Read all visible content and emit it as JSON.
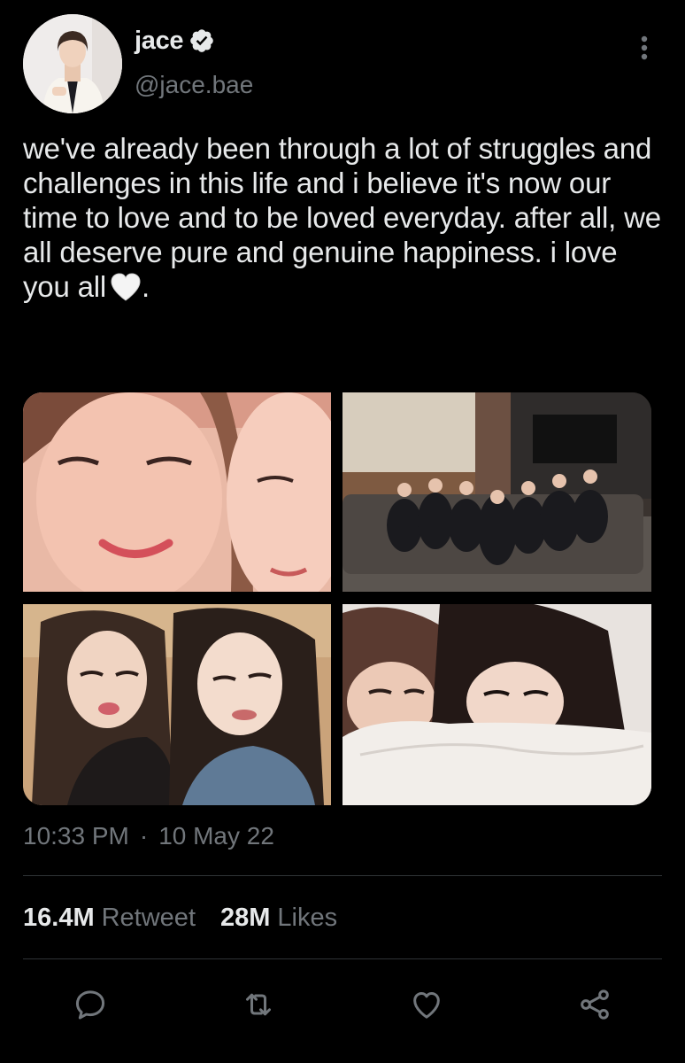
{
  "user": {
    "display_name": "jace",
    "handle": "@jace.bae",
    "verified": true,
    "avatar_icon": "profile-photo"
  },
  "tweet": {
    "text": "we've already been through a lot of struggles and challenges in this life and i believe it's now our time to love and to be loved everyday. after all, we all deserve pure and genuine happiness. i love you all",
    "text_suffix": ".",
    "emoji": "white-heart-emoji"
  },
  "media": {
    "photos": [
      {
        "name": "photo-1",
        "icon": "selfie-two-faces"
      },
      {
        "name": "photo-2",
        "icon": "group-photo-on-sofa"
      },
      {
        "name": "photo-3",
        "icon": "selfie-two-girls"
      },
      {
        "name": "photo-4",
        "icon": "two-faces-behind-pillow"
      }
    ]
  },
  "meta": {
    "time": "10:33 PM",
    "separator": "·",
    "date": "10 May 22"
  },
  "stats": {
    "retweets_count": "16.4M",
    "retweets_label": "Retweet",
    "likes_count": "28M",
    "likes_label": "Likes"
  },
  "actions": [
    {
      "name": "reply-icon"
    },
    {
      "name": "retweet-icon"
    },
    {
      "name": "like-icon"
    },
    {
      "name": "share-icon"
    }
  ],
  "colors": {
    "background": "#000000",
    "primary_text": "#e7e9ea",
    "secondary_text": "#71767b",
    "divider": "#2f3336"
  }
}
